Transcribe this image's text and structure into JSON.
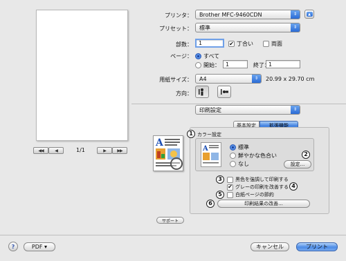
{
  "preview": {
    "first_label": "◀◀",
    "prev_label": "◀",
    "page_counter": "1/1",
    "next_label": "▶",
    "last_label": "▶▶"
  },
  "printer": {
    "label": "プリンタ：",
    "value": "Brother MFC-9460CDN"
  },
  "presets": {
    "label": "プリセット：",
    "value": "標準"
  },
  "copies": {
    "label": "部数：",
    "value": "1",
    "collated_label": "丁合い",
    "collated_checked": true,
    "duplex_label": "両面",
    "duplex_checked": false
  },
  "pages": {
    "label": "ページ：",
    "all_label": "すべて",
    "from_label": "開始：",
    "from_value": "1",
    "to_label": "終了：",
    "to_value": "1"
  },
  "paper_size": {
    "label": "用紙サイズ：",
    "value": "A4",
    "dimensions": "20.99 x 29.70 cm"
  },
  "orientation": {
    "label": "方向："
  },
  "section_popup": {
    "value": "印刷設定"
  },
  "tabs": [
    {
      "label": "基本設定"
    },
    {
      "label": "拡張機能"
    }
  ],
  "color_settings": {
    "label": "カラー設定",
    "options": [
      {
        "label": "標準",
        "selected": true
      },
      {
        "label": "鮮やかな色合い",
        "selected": false
      },
      {
        "label": "なし",
        "selected": false
      }
    ],
    "settings_button": "設定..."
  },
  "options": {
    "enhance_black_label": "黒色を強調して印刷する",
    "enhance_black_checked": false,
    "improve_gray_label": "グレーの印刷を改善する",
    "improve_gray_checked": true,
    "skip_blank_label": "白紙ページの節約",
    "skip_blank_checked": false,
    "improve_output_button": "印刷結果の改善..."
  },
  "callouts": [
    "1",
    "2",
    "3",
    "4",
    "5",
    "6"
  ],
  "support_button": "サポート",
  "footer": {
    "help_label": "?",
    "pdf_label": "PDF ▾",
    "cancel_label": "キャンセル",
    "print_label": "プリント"
  },
  "colors": {
    "accent": "#3a72d8",
    "window_bg": "#e8e8e8"
  }
}
